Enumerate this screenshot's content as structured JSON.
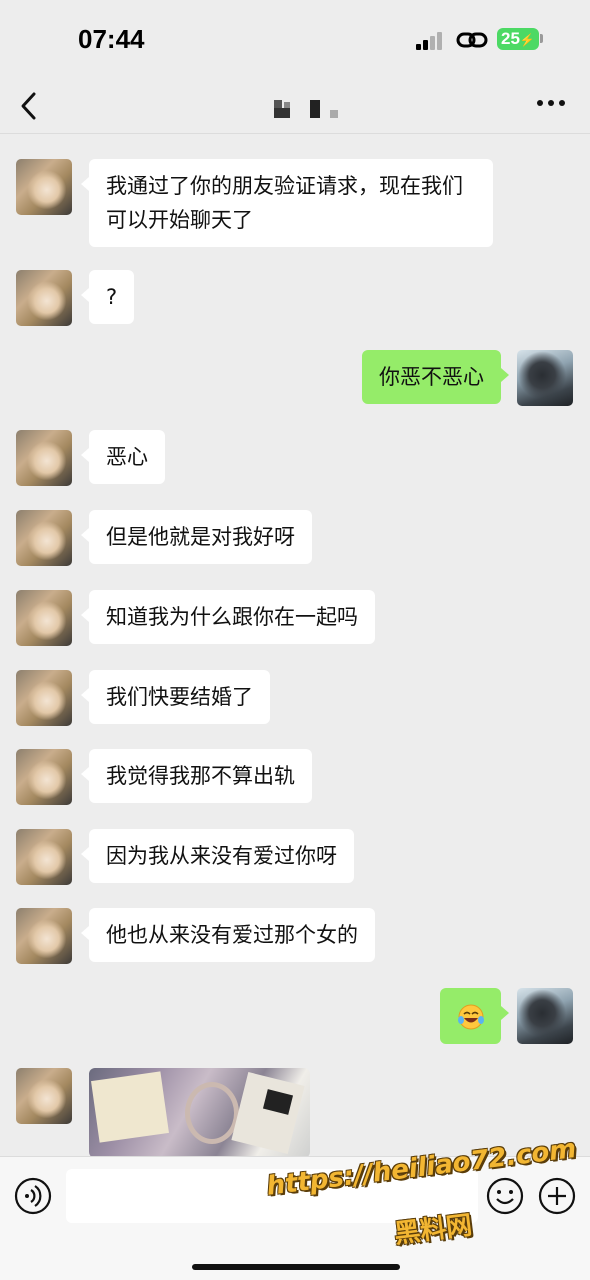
{
  "status_bar": {
    "time": "07:44",
    "battery": "25",
    "icons": [
      "signal-icon",
      "link-icon",
      "battery-icon"
    ]
  },
  "nav": {
    "back_icon": "chevron-left-icon",
    "title": "",
    "more_icon": "more-dots-icon"
  },
  "messages": [
    {
      "side": "in",
      "type": "text",
      "text": "我通过了你的朋友验证请求，现在我们可以开始聊天了"
    },
    {
      "side": "in",
      "type": "text",
      "text": "?"
    },
    {
      "side": "out",
      "type": "text",
      "text": "你恶不恶心"
    },
    {
      "side": "in",
      "type": "text",
      "text": "恶心"
    },
    {
      "side": "in",
      "type": "text",
      "text": "但是他就是对我好呀"
    },
    {
      "side": "in",
      "type": "text",
      "text": "知道我为什么跟你在一起吗"
    },
    {
      "side": "in",
      "type": "text",
      "text": "我们快要结婚了"
    },
    {
      "side": "in",
      "type": "text",
      "text": "我觉得我那不算出轨"
    },
    {
      "side": "in",
      "type": "text",
      "text": "因为我从来没有爱过你呀"
    },
    {
      "side": "in",
      "type": "text",
      "text": "他也从来没有爱过那个女的"
    },
    {
      "side": "out",
      "type": "emoji",
      "emoji": "laughing-crying-emoji"
    },
    {
      "side": "in",
      "type": "image",
      "image": "photo-thumbnail"
    }
  ],
  "input_bar": {
    "voice_icon": "voice-icon",
    "placeholder": "",
    "emoji_icon": "emoji-icon",
    "plus_icon": "plus-icon"
  },
  "watermark": {
    "url": "https://heiliao72.com",
    "text": "黑料网"
  },
  "colors": {
    "background": "#ededed",
    "incoming_bubble": "#ffffff",
    "outgoing_bubble": "#95ec69",
    "battery": "#4cd964",
    "watermark": "#f2b632"
  }
}
